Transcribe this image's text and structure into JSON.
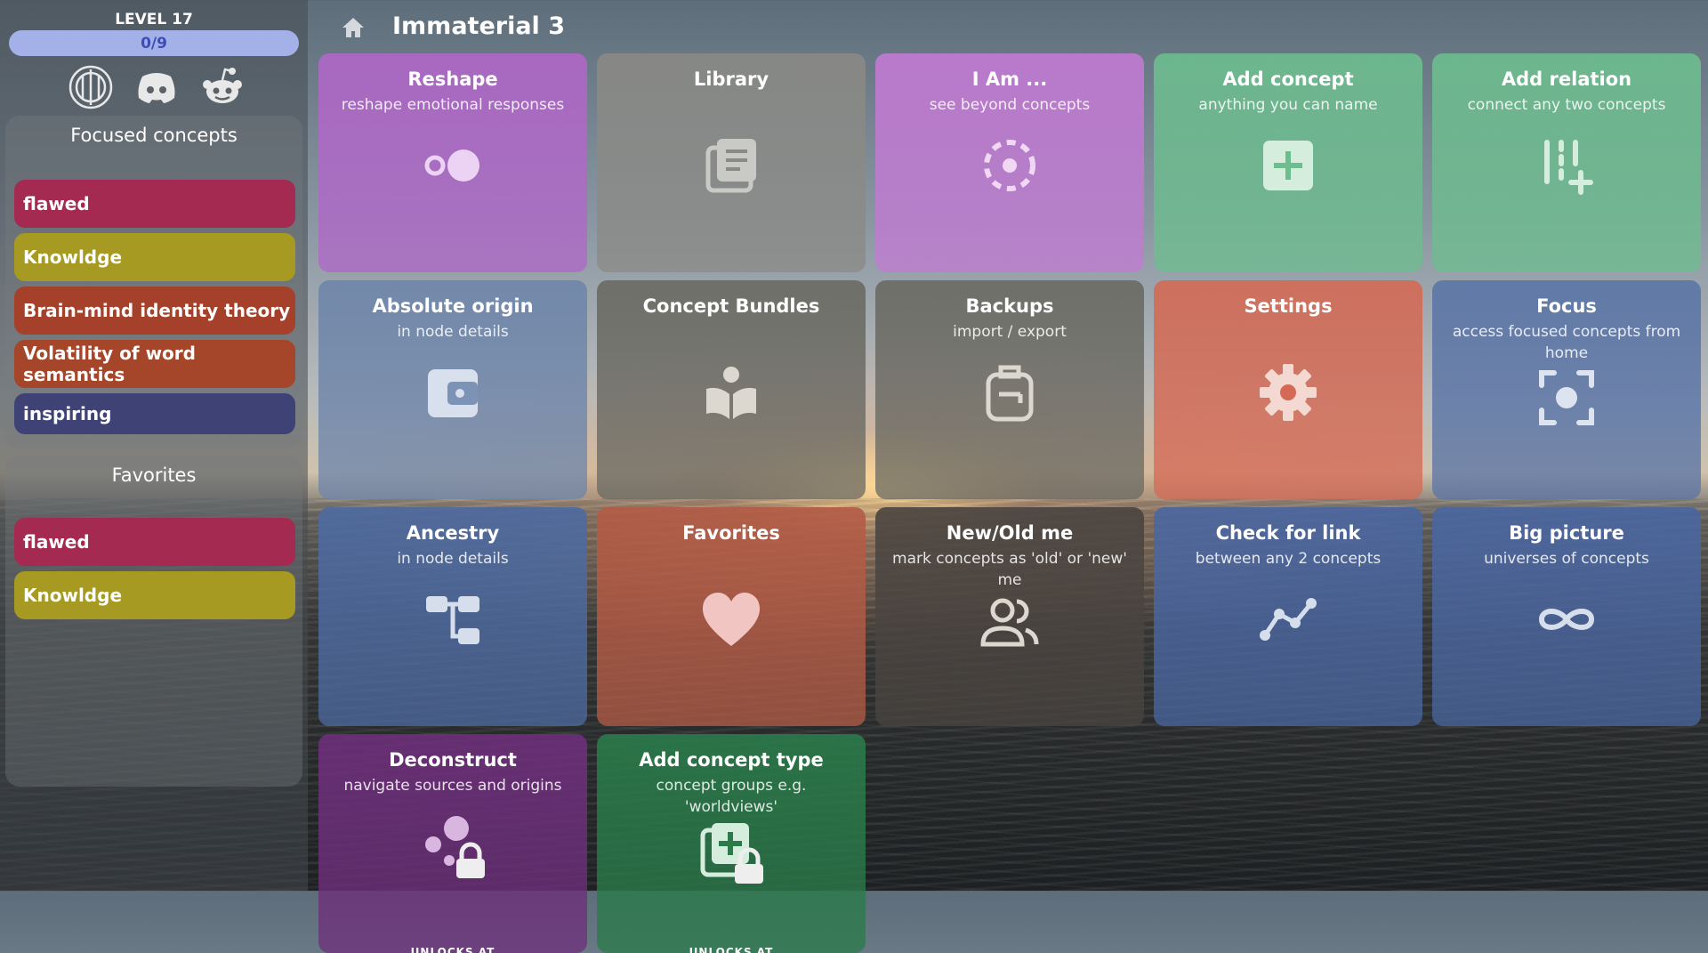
{
  "app": {
    "title": "Immaterial 3"
  },
  "sidebar": {
    "level_label": "LEVEL 17",
    "progress_text": "0/9",
    "progress_fraction": 0.0,
    "social_icons": [
      "immaterial-logo-icon",
      "discord-icon",
      "reddit-icon"
    ],
    "focused": {
      "title": "Focused concepts",
      "items": [
        {
          "label": "flawed",
          "color": "#a52a52"
        },
        {
          "label": "Knowldge",
          "color": "#a69a22"
        },
        {
          "label": "Brain-mind identity theory",
          "color": "#a5412a"
        },
        {
          "label": "Volatility of word semantics",
          "color": "#a5452a"
        },
        {
          "label": "inspiring",
          "color": "#3e4275"
        }
      ]
    },
    "favorites": {
      "title": "Favorites",
      "items": [
        {
          "label": "flawed",
          "color": "#a52a52"
        },
        {
          "label": "Knowldge",
          "color": "#a69a22"
        }
      ]
    }
  },
  "tiles": [
    {
      "title": "Reshape",
      "subtitle": "reshape emotional responses",
      "icon": "reshape-icon",
      "color": "#b067c8"
    },
    {
      "title": "Library",
      "subtitle": "",
      "icon": "library-icon",
      "color": "#8a8a86"
    },
    {
      "title": "I Am ...",
      "subtitle": "see beyond concepts",
      "icon": "dashed-circle-icon",
      "color": "#c27ad3"
    },
    {
      "title": "Add concept",
      "subtitle": "anything you can name",
      "icon": "plus-square-icon",
      "color": "#6dbd8f"
    },
    {
      "title": "Add relation",
      "subtitle": "connect any two concepts",
      "icon": "add-relation-icon",
      "color": "#6dbd8f"
    },
    {
      "title": "Absolute origin",
      "subtitle": "in node details",
      "icon": "wallet-icon",
      "color": "#6f86aa"
    },
    {
      "title": "Concept Bundles",
      "subtitle": "",
      "icon": "book-reader-icon",
      "color": "#6b6a63"
    },
    {
      "title": "Backups",
      "subtitle": "import / export",
      "icon": "backpack-icon",
      "color": "#6b6a63"
    },
    {
      "title": "Settings",
      "subtitle": "",
      "icon": "gear-icon",
      "color": "#d46a55"
    },
    {
      "title": "Focus",
      "subtitle": "access focused concepts from home",
      "icon": "focus-icon",
      "color": "#5b75a6"
    },
    {
      "title": "Ancestry",
      "subtitle": "in node details",
      "icon": "tree-icon",
      "color": "#4d6aa0"
    },
    {
      "title": "Favorites",
      "subtitle": "",
      "icon": "heart-icon",
      "color": "#b35b45"
    },
    {
      "title": "New/Old me",
      "subtitle": "mark concepts as 'old' or 'new' me",
      "icon": "users-icon",
      "color": "#4a4440"
    },
    {
      "title": "Check for link",
      "subtitle": "between any 2 concepts",
      "icon": "link-graph-icon",
      "color": "#4a66a0"
    },
    {
      "title": "Big picture",
      "subtitle": "universes of concepts",
      "icon": "infinity-icon",
      "color": "#4a66a0"
    },
    {
      "title": "Deconstruct",
      "subtitle": "navigate sources and origins",
      "icon": "deconstruct-locked-icon",
      "color": "#6d2f7a",
      "locked_text": "UNLOCKS AT"
    },
    {
      "title": "Add concept type",
      "subtitle": "concept groups e.g. 'worldviews'",
      "icon": "add-type-locked-icon",
      "color": "#2a7a4a",
      "locked_text": "UNLOCKS AT"
    }
  ]
}
